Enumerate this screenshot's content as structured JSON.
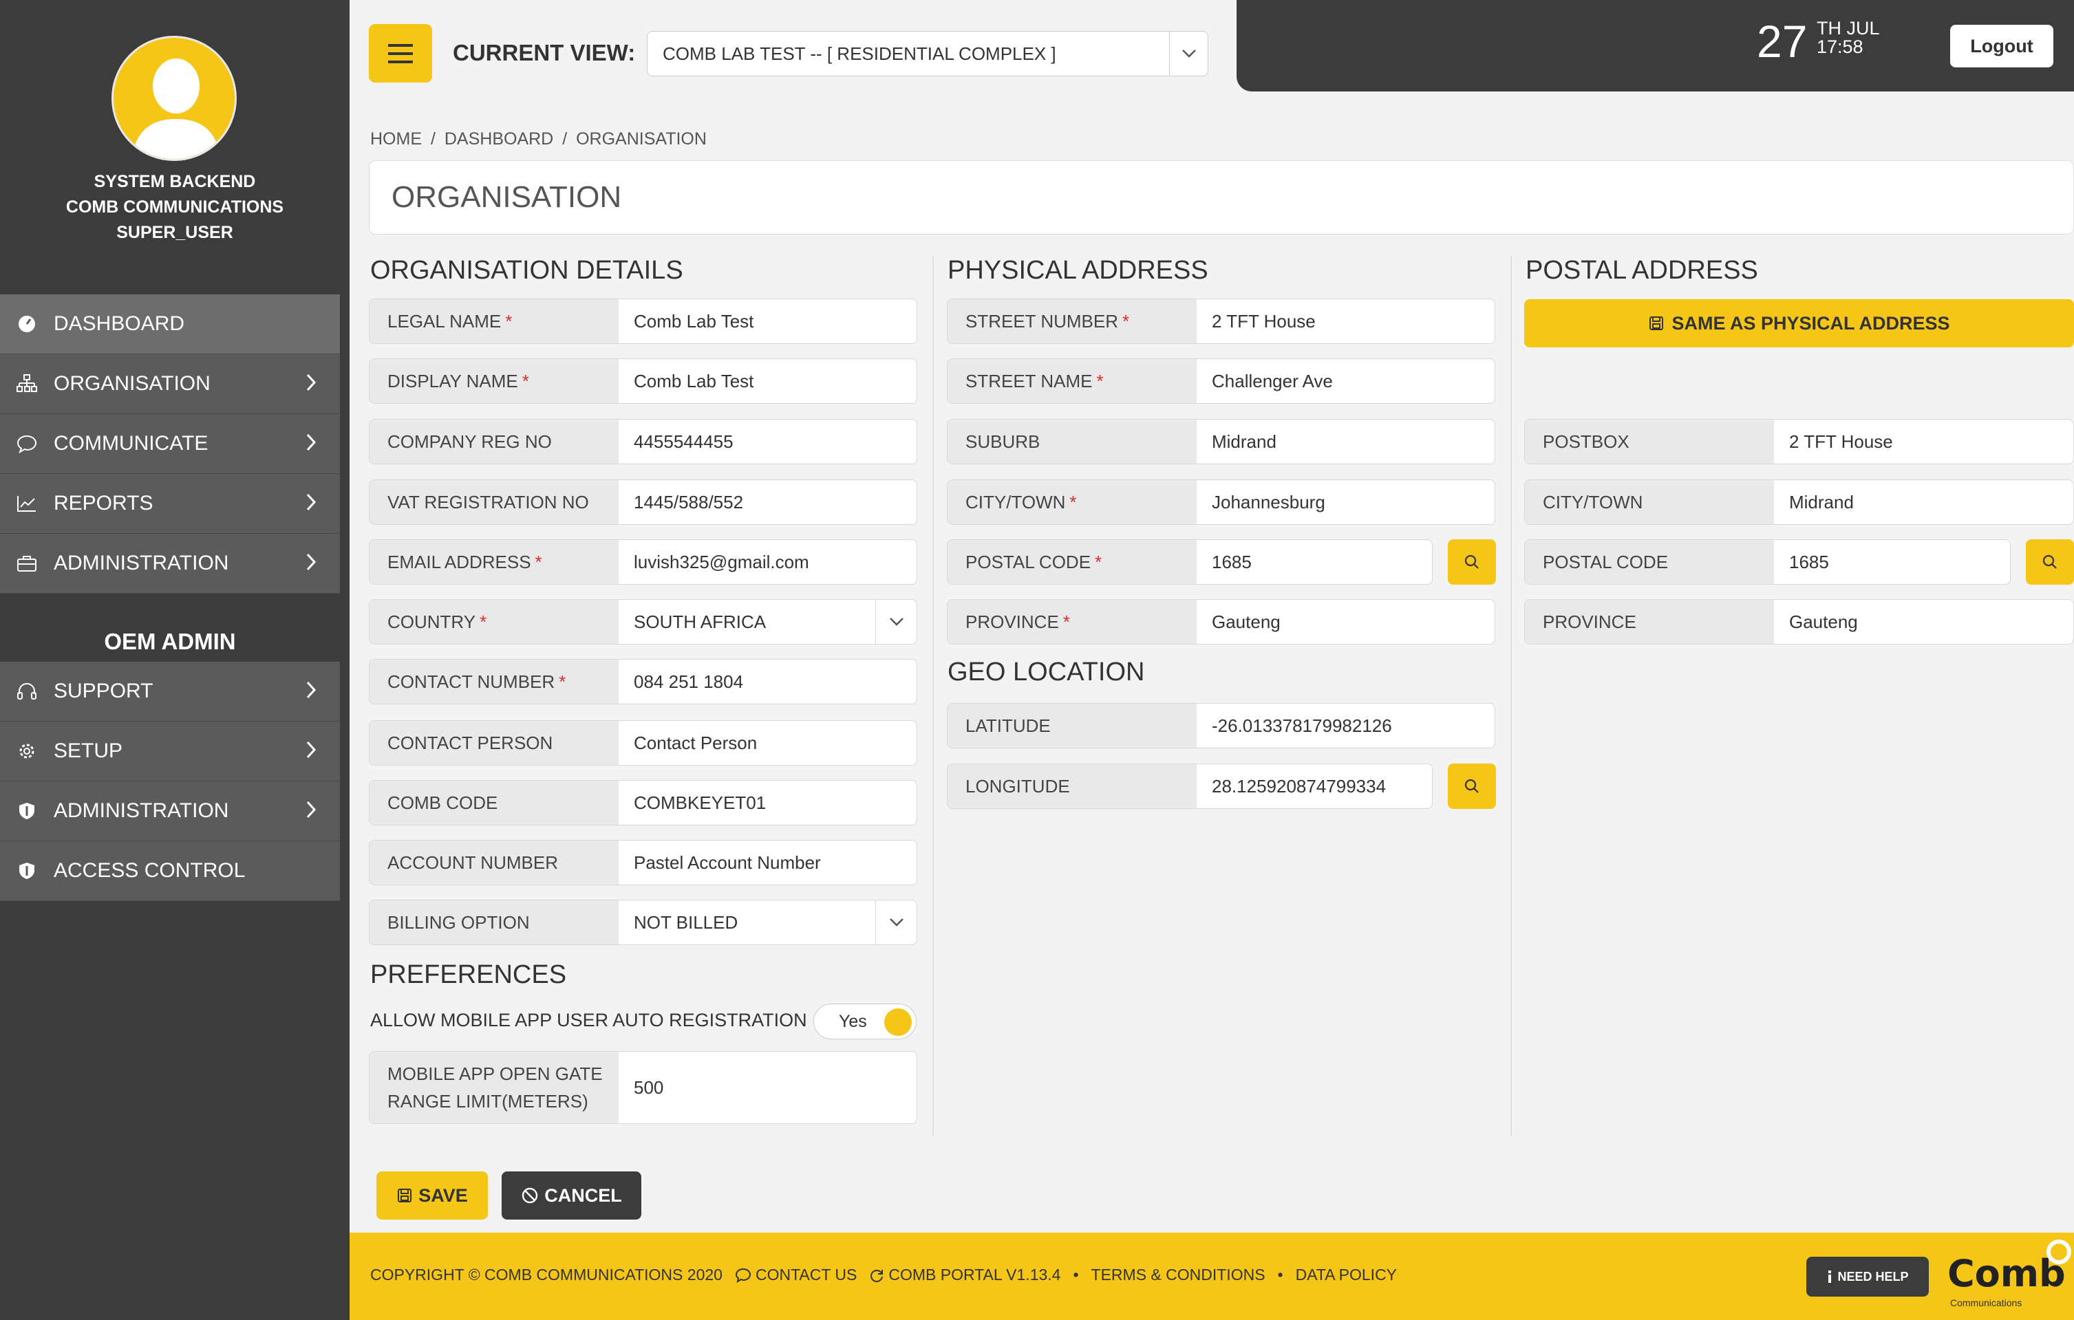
{
  "user": {
    "name": "SYSTEM BACKEND",
    "company": "COMB COMMUNICATIONS",
    "role": "SUPER_USER"
  },
  "sidebar": {
    "items": [
      {
        "label": "DASHBOARD",
        "icon": "dashboard-icon"
      },
      {
        "label": "ORGANISATION",
        "icon": "organisation-icon"
      },
      {
        "label": "COMMUNICATE",
        "icon": "chat-icon"
      },
      {
        "label": "REPORTS",
        "icon": "chart-icon"
      },
      {
        "label": "ADMINISTRATION",
        "icon": "briefcase-icon"
      }
    ],
    "oem_title": "OEM ADMIN",
    "oem_items": [
      {
        "label": "SUPPORT",
        "icon": "headset-icon"
      },
      {
        "label": "SETUP",
        "icon": "gear-icon"
      },
      {
        "label": "ADMINISTRATION",
        "icon": "shield-icon"
      },
      {
        "label": "ACCESS CONTROL",
        "icon": "shield-icon"
      }
    ]
  },
  "header": {
    "current_view_label": "CURRENT VIEW:",
    "current_view_value": "COMB LAB TEST -- [ RESIDENTIAL COMPLEX ]",
    "date_day": "27",
    "date_suffix": "TH JUL",
    "time": "17:58",
    "logout_label": "Logout"
  },
  "breadcrumb": [
    "HOME",
    "/",
    "DASHBOARD",
    "/",
    "ORGANISATION"
  ],
  "page_title": "ORGANISATION",
  "organisation_details": {
    "heading": "ORGANISATION DETAILS",
    "fields": [
      {
        "label": "LEGAL NAME",
        "required": "*",
        "value": "Comb Lab Test"
      },
      {
        "label": "DISPLAY NAME",
        "required": "*",
        "value": "Comb Lab Test"
      },
      {
        "label": "COMPANY REG NO",
        "required": "",
        "value": "4455544455"
      },
      {
        "label": "VAT REGISTRATION NO",
        "required": "",
        "value": "1445/588/552"
      },
      {
        "label": "EMAIL ADDRESS",
        "required": "*",
        "value": "luvish325@gmail.com"
      },
      {
        "label": "COUNTRY",
        "required": "*",
        "value": "SOUTH AFRICA"
      },
      {
        "label": "CONTACT NUMBER",
        "required": "*",
        "value": "084 251 1804"
      },
      {
        "label": "CONTACT PERSON",
        "required": "",
        "value": "Contact Person"
      },
      {
        "label": "COMB CODE",
        "required": "",
        "value": "COMBKEYET01"
      },
      {
        "label": "ACCOUNT NUMBER",
        "required": "",
        "value": "Pastel Account Number"
      },
      {
        "label": "BILLING OPTION",
        "required": "",
        "value": "NOT BILLED"
      }
    ]
  },
  "preferences": {
    "heading": "PREFERENCES",
    "auto_reg_label": "ALLOW MOBILE APP USER AUTO REGISTRATION",
    "auto_reg_value": "Yes",
    "gate_range_label_1": "MOBILE APP OPEN GATE",
    "gate_range_label_2": "RANGE LIMIT(METERS)",
    "gate_range_value": "500"
  },
  "physical_address": {
    "heading": "PHYSICAL ADDRESS",
    "fields": [
      {
        "label": "STREET NUMBER",
        "required": "*",
        "value": "2 TFT House"
      },
      {
        "label": "STREET NAME",
        "required": "*",
        "value": "Challenger Ave"
      },
      {
        "label": "SUBURB",
        "required": "",
        "value": "Midrand"
      },
      {
        "label": "CITY/TOWN",
        "required": "*",
        "value": "Johannesburg"
      },
      {
        "label": "POSTAL CODE",
        "required": "*",
        "value": "1685"
      },
      {
        "label": "PROVINCE",
        "required": "*",
        "value": "Gauteng"
      }
    ]
  },
  "geo_location": {
    "heading": "GEO LOCATION",
    "fields": [
      {
        "label": "LATITUDE",
        "value": "-26.013378179982126"
      },
      {
        "label": "LONGITUDE",
        "value": "28.125920874799334"
      }
    ]
  },
  "postal_address": {
    "heading": "POSTAL ADDRESS",
    "same_as_label": "SAME AS PHYSICAL ADDRESS",
    "fields": [
      {
        "label": "POSTBOX",
        "value": "2 TFT House"
      },
      {
        "label": "CITY/TOWN",
        "value": "Midrand"
      },
      {
        "label": "POSTAL CODE",
        "value": "1685"
      },
      {
        "label": "PROVINCE",
        "value": "Gauteng"
      }
    ]
  },
  "actions": {
    "save_label": "SAVE",
    "cancel_label": "CANCEL"
  },
  "footer": {
    "copyright": "COPYRIGHT © COMB COMMUNICATIONS 2020",
    "contact_us": "CONTACT US",
    "portal_version": "COMB PORTAL V1.13.4",
    "bullet": "•",
    "terms": "TERMS & CONDITIONS",
    "data_policy": "DATA POLICY",
    "need_help": "NEED HELP",
    "logo_text": "Comb",
    "logo_sub": "Communications"
  },
  "colors": {
    "accent": "#f5c518",
    "sidebar_bg": "#3c3c3c",
    "nav_bg": "#5b5b5b",
    "required": "#d9302c"
  }
}
